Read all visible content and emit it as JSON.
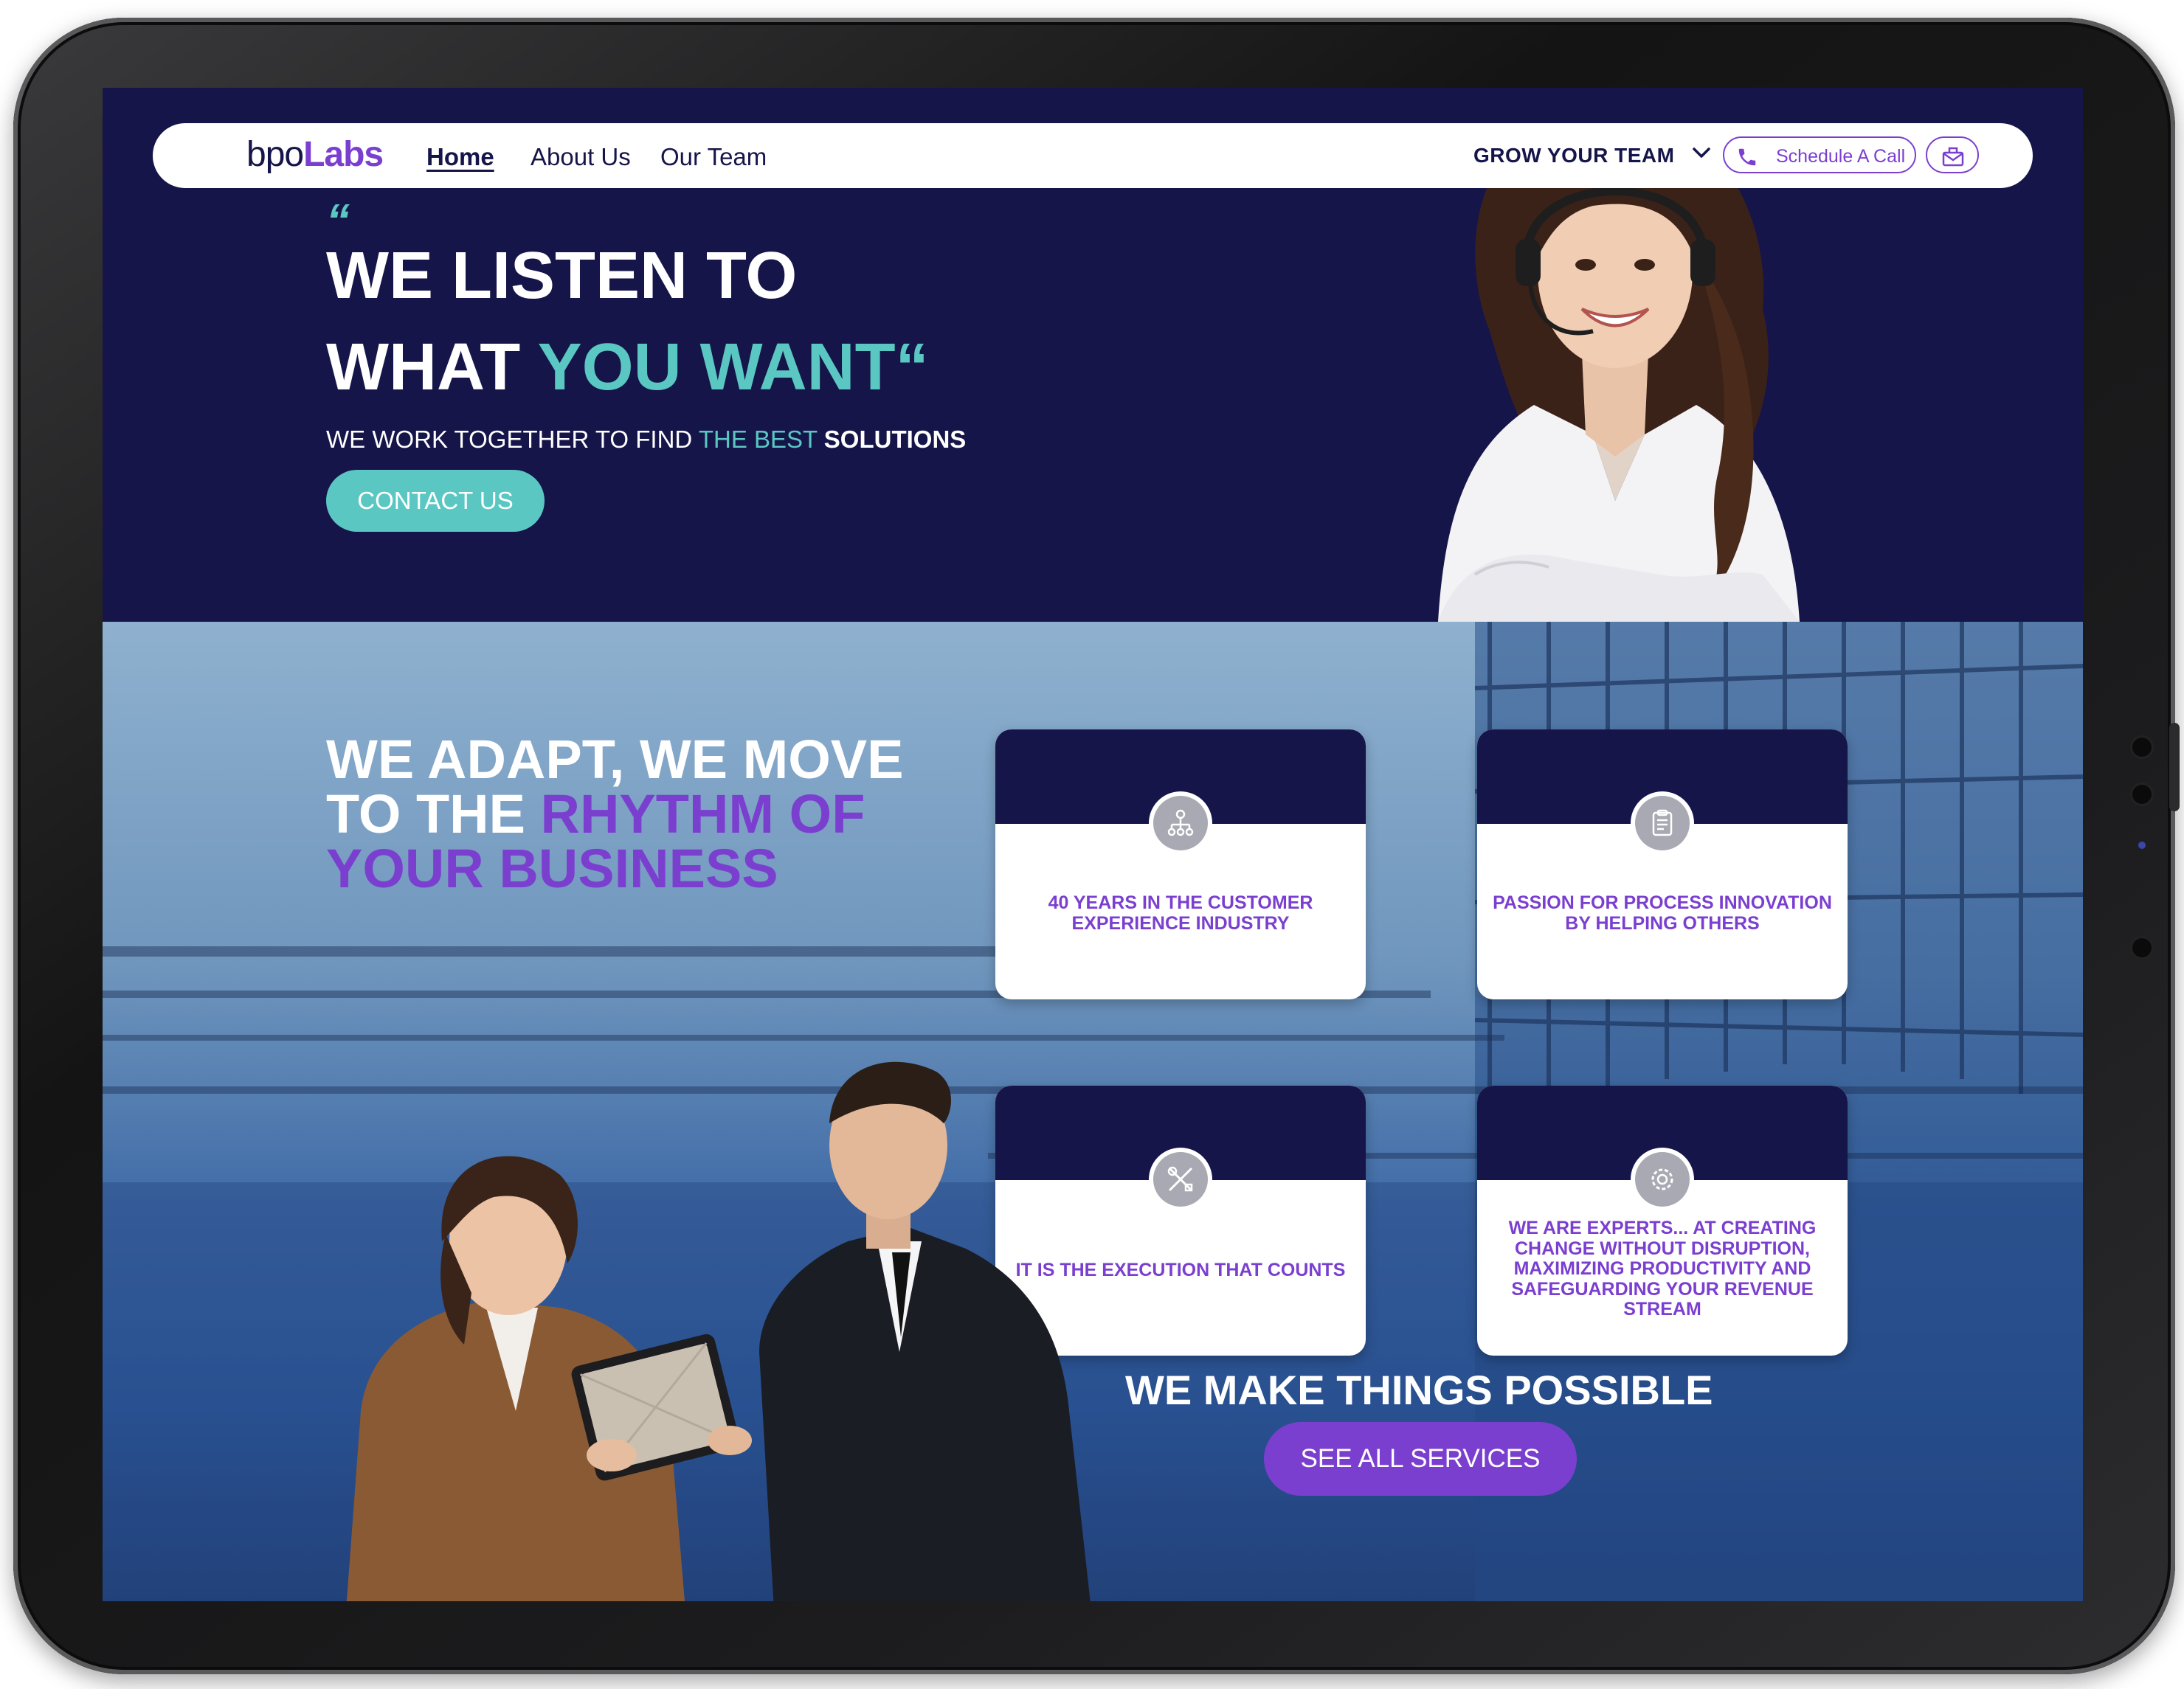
{
  "nav": {
    "logo_bpo": "bpo",
    "logo_labs": "Labs",
    "links": [
      {
        "label": "Home",
        "active": true
      },
      {
        "label": "About Us",
        "active": false
      },
      {
        "label": "Our Team",
        "active": false
      }
    ],
    "grow_label": "GROW YOUR TEAM",
    "schedule_label": "Schedule A Call"
  },
  "hero": {
    "quote_open": "“",
    "line1": "WE LISTEN TO",
    "line2_a": "WHAT ",
    "line2_b": "YOU WANT",
    "line2_c": "“",
    "sub_a": "WE WORK TOGETHER TO FIND ",
    "sub_b": "THE BEST ",
    "sub_c": "SOLUTIONS",
    "cta": "CONTACT US"
  },
  "section": {
    "line1": "WE ADAPT, WE MOVE",
    "line2_a": "TO THE ",
    "line2_b": "RHYTHM OF",
    "line3": "YOUR BUSINESS",
    "cards": [
      {
        "text": "40 YEARS IN THE CUSTOMER EXPERIENCE INDUSTRY",
        "icon": "org-chart-icon"
      },
      {
        "text": "PASSION FOR PROCESS INNOVATION BY HELPING OTHERS",
        "icon": "clipboard-icon"
      },
      {
        "text": "IT IS THE EXECUTION THAT COUNTS",
        "icon": "tools-icon"
      },
      {
        "text": "WE ARE EXPERTS... AT CREATING CHANGE WITHOUT DISRUPTION, MAXIMIZING PRODUCTIVITY AND SAFEGUARDING YOUR REVENUE STREAM",
        "icon": "gear-icon"
      }
    ],
    "possible": "WE MAKE THINGS POSSIBLE",
    "services_cta": "SEE ALL SERVICES"
  },
  "colors": {
    "navy": "#16154a",
    "teal": "#5bc7c2",
    "purple": "#7b3fd0",
    "white": "#ffffff"
  }
}
